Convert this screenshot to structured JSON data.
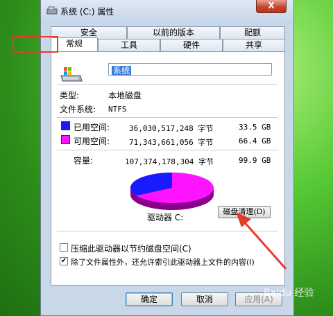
{
  "window": {
    "title": "系统 (C:) 属性",
    "close_label": "X"
  },
  "tabs": {
    "row1": [
      "安全",
      "以前的版本",
      "配额"
    ],
    "row2": [
      "常规",
      "工具",
      "硬件",
      "共享"
    ],
    "active": "常规"
  },
  "general": {
    "name_value": "系统",
    "type_label": "类型:",
    "type_value": "本地磁盘",
    "fs_label": "文件系统:",
    "fs_value": "NTFS",
    "used_label": "已用空间:",
    "used_bytes": "36,030,517,248 字节",
    "used_gb": "33.5 GB",
    "free_label": "可用空间:",
    "free_bytes": "71,343,661,056 字节",
    "free_gb": "66.4 GB",
    "capacity_label": "容量:",
    "capacity_bytes": "107,374,178,304 字节",
    "capacity_gb": "99.9 GB",
    "drive_label": "驱动器 C:",
    "cleanup_label": "磁盘清理(D)",
    "compress_label": "压缩此驱动器以节约磁盘空间(C)",
    "compress_checked": false,
    "index_label": "除了文件属性外，还允许索引此驱动器上文件的内容(I)",
    "index_checked": true
  },
  "buttons": {
    "ok": "确定",
    "cancel": "取消",
    "apply": "应用(A)"
  },
  "colors": {
    "used": "#1a1aff",
    "free": "#ff14ff"
  },
  "usage": {
    "used_fraction": 0.336,
    "free_fraction": 0.664
  },
  "watermark": "Baidu 经验"
}
